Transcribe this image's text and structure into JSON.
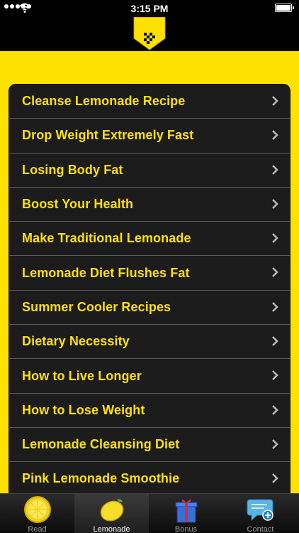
{
  "status_bar": {
    "time": "3:15 PM"
  },
  "colors": {
    "accent": "#FFE100",
    "list_bg": "#1c1c1c",
    "separator": "#5a5a5a"
  },
  "header": {
    "logo_icon": "taxi-checker-badge-icon"
  },
  "list": {
    "items": [
      {
        "label": "Cleanse Lemonade Recipe"
      },
      {
        "label": "Drop Weight Extremely Fast"
      },
      {
        "label": "Losing Body Fat"
      },
      {
        "label": "Boost Your Health"
      },
      {
        "label": "Make Traditional Lemonade"
      },
      {
        "label": "Lemonade Diet Flushes Fat"
      },
      {
        "label": "Summer Cooler Recipes"
      },
      {
        "label": "Dietary Necessity"
      },
      {
        "label": "How to Live Longer"
      },
      {
        "label": "How to Lose Weight"
      },
      {
        "label": "Lemonade Cleansing Diet"
      },
      {
        "label": "Pink Lemonade Smoothie"
      }
    ]
  },
  "tabbar": {
    "tabs": [
      {
        "label": "Read",
        "icon": "lemon-slice-icon"
      },
      {
        "label": "Lemonade",
        "icon": "lemon-icon",
        "active": true
      },
      {
        "label": "Bonus",
        "icon": "gift-box-icon"
      },
      {
        "label": "Contact",
        "icon": "chat-bubble-add-icon"
      }
    ]
  }
}
